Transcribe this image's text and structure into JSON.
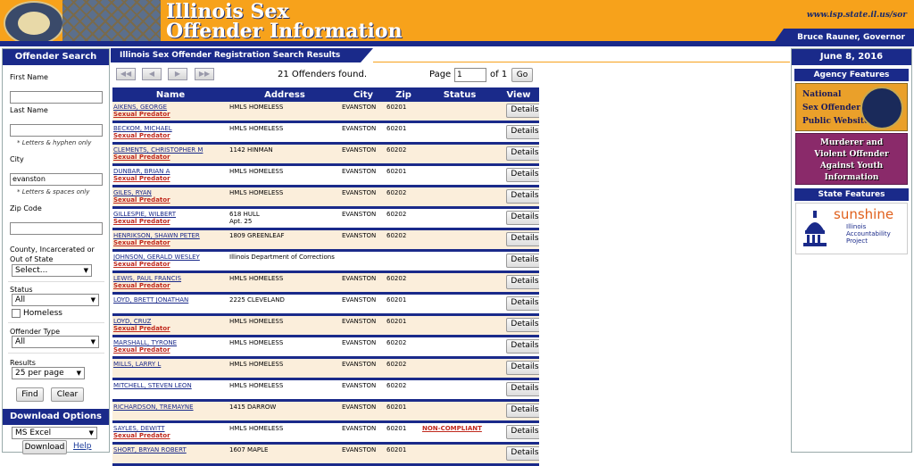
{
  "header": {
    "title_line1": "Illinois Sex",
    "title_line2": "Offender Information",
    "url": "www.isp.state.il.us/sor",
    "governor": "Bruce Rauner, Governor"
  },
  "search": {
    "title": "Offender Search",
    "first_name_label": "First Name",
    "first_name_value": "",
    "last_name_label": "Last Name",
    "last_name_value": "",
    "name_hint": "* Letters & hyphen only",
    "city_label": "City",
    "city_value": "evanston",
    "city_hint": "* Letters & spaces only",
    "zip_label": "Zip Code",
    "zip_value": "",
    "county_label_1": "County, Incarcerated or",
    "county_label_2": "Out of State",
    "county_value": "Select...",
    "status_label": "Status",
    "status_value": "All",
    "homeless_label": "Homeless",
    "offender_type_label": "Offender Type",
    "offender_type_value": "All",
    "results_label": "Results",
    "results_value": "25 per page",
    "find_label": "Find",
    "clear_label": "Clear"
  },
  "download": {
    "title": "Download Options",
    "format_value": "MS Excel",
    "download_label": "Download",
    "help_label": "Help"
  },
  "results": {
    "title": "Illinois Sex Offender Registration Search Results",
    "found_text": "21 Offenders found.",
    "page_label": "Page",
    "page_value": "1",
    "of_label": "of 1",
    "go_label": "Go",
    "columns": [
      "Name",
      "Address",
      "City",
      "Zip",
      "Status",
      "View"
    ],
    "details_label": "Details",
    "rows": [
      {
        "name": "AIKENS, GEORGE",
        "predator": "Sexual Predator",
        "address": "HMLS HOMELESS",
        "address2": "",
        "city": "EVANSTON",
        "zip": "60201",
        "status": ""
      },
      {
        "name": "BECKOM, MICHAEL",
        "predator": "Sexual Predator",
        "address": "HMLS HOMELESS",
        "address2": "",
        "city": "EVANSTON",
        "zip": "60201",
        "status": ""
      },
      {
        "name": "CLEMENTS, CHRISTOPHER M",
        "predator": "Sexual Predator",
        "address": "1142 HINMAN",
        "address2": "",
        "city": "EVANSTON",
        "zip": "60202",
        "status": ""
      },
      {
        "name": "DUNBAR, BRIAN A",
        "predator": "Sexual Predator",
        "address": "HMLS HOMELESS",
        "address2": "",
        "city": "EVANSTON",
        "zip": "60201",
        "status": ""
      },
      {
        "name": "GILES, RYAN",
        "predator": "Sexual Predator",
        "address": "HMLS HOMELESS",
        "address2": "",
        "city": "EVANSTON",
        "zip": "60202",
        "status": ""
      },
      {
        "name": "GILLESPIE, WILBERT",
        "predator": "Sexual Predator",
        "address": "618 HULL",
        "address2": "Apt. 25",
        "city": "EVANSTON",
        "zip": "60202",
        "status": ""
      },
      {
        "name": "HENRIKSON, SHAWN PETER",
        "predator": "Sexual Predator",
        "address": "1809 GREENLEAF",
        "address2": "",
        "city": "EVANSTON",
        "zip": "60202",
        "status": ""
      },
      {
        "name": "JOHNSON, GERALD WESLEY",
        "predator": "Sexual Predator",
        "address": "Illinois Department of Corrections",
        "address2": "",
        "city": "",
        "zip": "",
        "status": ""
      },
      {
        "name": "LEWIS, PAUL FRANCIS",
        "predator": "Sexual Predator",
        "address": "HMLS HOMELESS",
        "address2": "",
        "city": "EVANSTON",
        "zip": "60202",
        "status": ""
      },
      {
        "name": "LOYD, BRETT JONATHAN",
        "predator": "",
        "address": "2225 CLEVELAND",
        "address2": "",
        "city": "EVANSTON",
        "zip": "60201",
        "status": ""
      },
      {
        "name": "LOYD, CRUZ",
        "predator": "Sexual Predator",
        "address": "HMLS HOMELESS",
        "address2": "",
        "city": "EVANSTON",
        "zip": "60201",
        "status": ""
      },
      {
        "name": "MARSHALL, TYRONE",
        "predator": "Sexual Predator",
        "address": "HMLS HOMELESS",
        "address2": "",
        "city": "EVANSTON",
        "zip": "60202",
        "status": ""
      },
      {
        "name": "MILLS, LARRY L",
        "predator": "",
        "address": "HMLS HOMELESS",
        "address2": "",
        "city": "EVANSTON",
        "zip": "60202",
        "status": ""
      },
      {
        "name": "MITCHELL, STEVEN LEON",
        "predator": "",
        "address": "HMLS HOMELESS",
        "address2": "",
        "city": "EVANSTON",
        "zip": "60202",
        "status": ""
      },
      {
        "name": "RICHARDSON, TREMAYNE",
        "predator": "",
        "address": "1415 DARROW",
        "address2": "",
        "city": "EVANSTON",
        "zip": "60201",
        "status": ""
      },
      {
        "name": "SAYLES, DEWITT",
        "predator": "Sexual Predator",
        "address": "HMLS HOMELESS",
        "address2": "",
        "city": "EVANSTON",
        "zip": "60201",
        "status": "NON-COMPLIANT"
      },
      {
        "name": "SHORT, BRYAN ROBERT",
        "predator": "",
        "address": "1607 MAPLE",
        "address2": "",
        "city": "EVANSTON",
        "zip": "60201",
        "status": ""
      }
    ]
  },
  "right": {
    "date": "June 8, 2016",
    "agency_title": "Agency Features",
    "nsopw_line1": "National",
    "nsopw_line2": "Sex Offender",
    "nsopw_line3": "Public Website",
    "murderer_line1": "Murderer and",
    "murderer_line2": "Violent Offender",
    "murderer_line3": "Against Youth",
    "murderer_line4": "Information",
    "state_title": "State Features",
    "sunshine": "sunshine",
    "sunshine_sub1": "Illinois",
    "sunshine_sub2": "Accountability",
    "sunshine_sub3": "Project"
  },
  "colors": {
    "header_orange": "#f7a21b",
    "navy": "#1a2a8a",
    "row_tint": "#fbeedb",
    "predator_red": "#c0281c"
  }
}
